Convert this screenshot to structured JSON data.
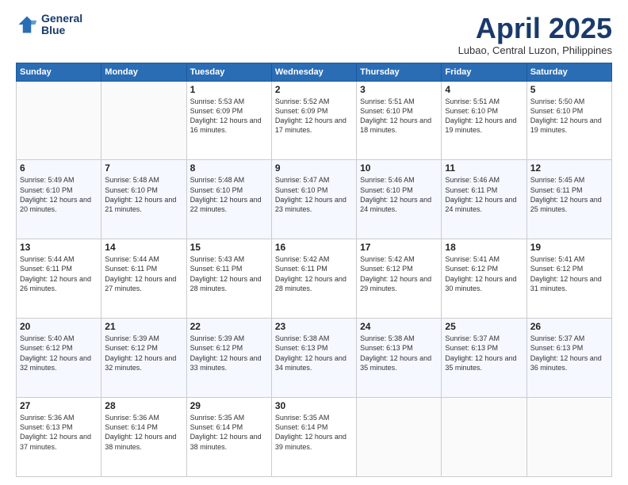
{
  "logo": {
    "line1": "General",
    "line2": "Blue"
  },
  "title": "April 2025",
  "subtitle": "Lubao, Central Luzon, Philippines",
  "days_of_week": [
    "Sunday",
    "Monday",
    "Tuesday",
    "Wednesday",
    "Thursday",
    "Friday",
    "Saturday"
  ],
  "weeks": [
    [
      {
        "day": "",
        "sunrise": "",
        "sunset": "",
        "daylight": ""
      },
      {
        "day": "",
        "sunrise": "",
        "sunset": "",
        "daylight": ""
      },
      {
        "day": "1",
        "sunrise": "Sunrise: 5:53 AM",
        "sunset": "Sunset: 6:09 PM",
        "daylight": "Daylight: 12 hours and 16 minutes."
      },
      {
        "day": "2",
        "sunrise": "Sunrise: 5:52 AM",
        "sunset": "Sunset: 6:09 PM",
        "daylight": "Daylight: 12 hours and 17 minutes."
      },
      {
        "day": "3",
        "sunrise": "Sunrise: 5:51 AM",
        "sunset": "Sunset: 6:10 PM",
        "daylight": "Daylight: 12 hours and 18 minutes."
      },
      {
        "day": "4",
        "sunrise": "Sunrise: 5:51 AM",
        "sunset": "Sunset: 6:10 PM",
        "daylight": "Daylight: 12 hours and 19 minutes."
      },
      {
        "day": "5",
        "sunrise": "Sunrise: 5:50 AM",
        "sunset": "Sunset: 6:10 PM",
        "daylight": "Daylight: 12 hours and 19 minutes."
      }
    ],
    [
      {
        "day": "6",
        "sunrise": "Sunrise: 5:49 AM",
        "sunset": "Sunset: 6:10 PM",
        "daylight": "Daylight: 12 hours and 20 minutes."
      },
      {
        "day": "7",
        "sunrise": "Sunrise: 5:48 AM",
        "sunset": "Sunset: 6:10 PM",
        "daylight": "Daylight: 12 hours and 21 minutes."
      },
      {
        "day": "8",
        "sunrise": "Sunrise: 5:48 AM",
        "sunset": "Sunset: 6:10 PM",
        "daylight": "Daylight: 12 hours and 22 minutes."
      },
      {
        "day": "9",
        "sunrise": "Sunrise: 5:47 AM",
        "sunset": "Sunset: 6:10 PM",
        "daylight": "Daylight: 12 hours and 23 minutes."
      },
      {
        "day": "10",
        "sunrise": "Sunrise: 5:46 AM",
        "sunset": "Sunset: 6:10 PM",
        "daylight": "Daylight: 12 hours and 24 minutes."
      },
      {
        "day": "11",
        "sunrise": "Sunrise: 5:46 AM",
        "sunset": "Sunset: 6:11 PM",
        "daylight": "Daylight: 12 hours and 24 minutes."
      },
      {
        "day": "12",
        "sunrise": "Sunrise: 5:45 AM",
        "sunset": "Sunset: 6:11 PM",
        "daylight": "Daylight: 12 hours and 25 minutes."
      }
    ],
    [
      {
        "day": "13",
        "sunrise": "Sunrise: 5:44 AM",
        "sunset": "Sunset: 6:11 PM",
        "daylight": "Daylight: 12 hours and 26 minutes."
      },
      {
        "day": "14",
        "sunrise": "Sunrise: 5:44 AM",
        "sunset": "Sunset: 6:11 PM",
        "daylight": "Daylight: 12 hours and 27 minutes."
      },
      {
        "day": "15",
        "sunrise": "Sunrise: 5:43 AM",
        "sunset": "Sunset: 6:11 PM",
        "daylight": "Daylight: 12 hours and 28 minutes."
      },
      {
        "day": "16",
        "sunrise": "Sunrise: 5:42 AM",
        "sunset": "Sunset: 6:11 PM",
        "daylight": "Daylight: 12 hours and 28 minutes."
      },
      {
        "day": "17",
        "sunrise": "Sunrise: 5:42 AM",
        "sunset": "Sunset: 6:12 PM",
        "daylight": "Daylight: 12 hours and 29 minutes."
      },
      {
        "day": "18",
        "sunrise": "Sunrise: 5:41 AM",
        "sunset": "Sunset: 6:12 PM",
        "daylight": "Daylight: 12 hours and 30 minutes."
      },
      {
        "day": "19",
        "sunrise": "Sunrise: 5:41 AM",
        "sunset": "Sunset: 6:12 PM",
        "daylight": "Daylight: 12 hours and 31 minutes."
      }
    ],
    [
      {
        "day": "20",
        "sunrise": "Sunrise: 5:40 AM",
        "sunset": "Sunset: 6:12 PM",
        "daylight": "Daylight: 12 hours and 32 minutes."
      },
      {
        "day": "21",
        "sunrise": "Sunrise: 5:39 AM",
        "sunset": "Sunset: 6:12 PM",
        "daylight": "Daylight: 12 hours and 32 minutes."
      },
      {
        "day": "22",
        "sunrise": "Sunrise: 5:39 AM",
        "sunset": "Sunset: 6:12 PM",
        "daylight": "Daylight: 12 hours and 33 minutes."
      },
      {
        "day": "23",
        "sunrise": "Sunrise: 5:38 AM",
        "sunset": "Sunset: 6:13 PM",
        "daylight": "Daylight: 12 hours and 34 minutes."
      },
      {
        "day": "24",
        "sunrise": "Sunrise: 5:38 AM",
        "sunset": "Sunset: 6:13 PM",
        "daylight": "Daylight: 12 hours and 35 minutes."
      },
      {
        "day": "25",
        "sunrise": "Sunrise: 5:37 AM",
        "sunset": "Sunset: 6:13 PM",
        "daylight": "Daylight: 12 hours and 35 minutes."
      },
      {
        "day": "26",
        "sunrise": "Sunrise: 5:37 AM",
        "sunset": "Sunset: 6:13 PM",
        "daylight": "Daylight: 12 hours and 36 minutes."
      }
    ],
    [
      {
        "day": "27",
        "sunrise": "Sunrise: 5:36 AM",
        "sunset": "Sunset: 6:13 PM",
        "daylight": "Daylight: 12 hours and 37 minutes."
      },
      {
        "day": "28",
        "sunrise": "Sunrise: 5:36 AM",
        "sunset": "Sunset: 6:14 PM",
        "daylight": "Daylight: 12 hours and 38 minutes."
      },
      {
        "day": "29",
        "sunrise": "Sunrise: 5:35 AM",
        "sunset": "Sunset: 6:14 PM",
        "daylight": "Daylight: 12 hours and 38 minutes."
      },
      {
        "day": "30",
        "sunrise": "Sunrise: 5:35 AM",
        "sunset": "Sunset: 6:14 PM",
        "daylight": "Daylight: 12 hours and 39 minutes."
      },
      {
        "day": "",
        "sunrise": "",
        "sunset": "",
        "daylight": ""
      },
      {
        "day": "",
        "sunrise": "",
        "sunset": "",
        "daylight": ""
      },
      {
        "day": "",
        "sunrise": "",
        "sunset": "",
        "daylight": ""
      }
    ]
  ]
}
